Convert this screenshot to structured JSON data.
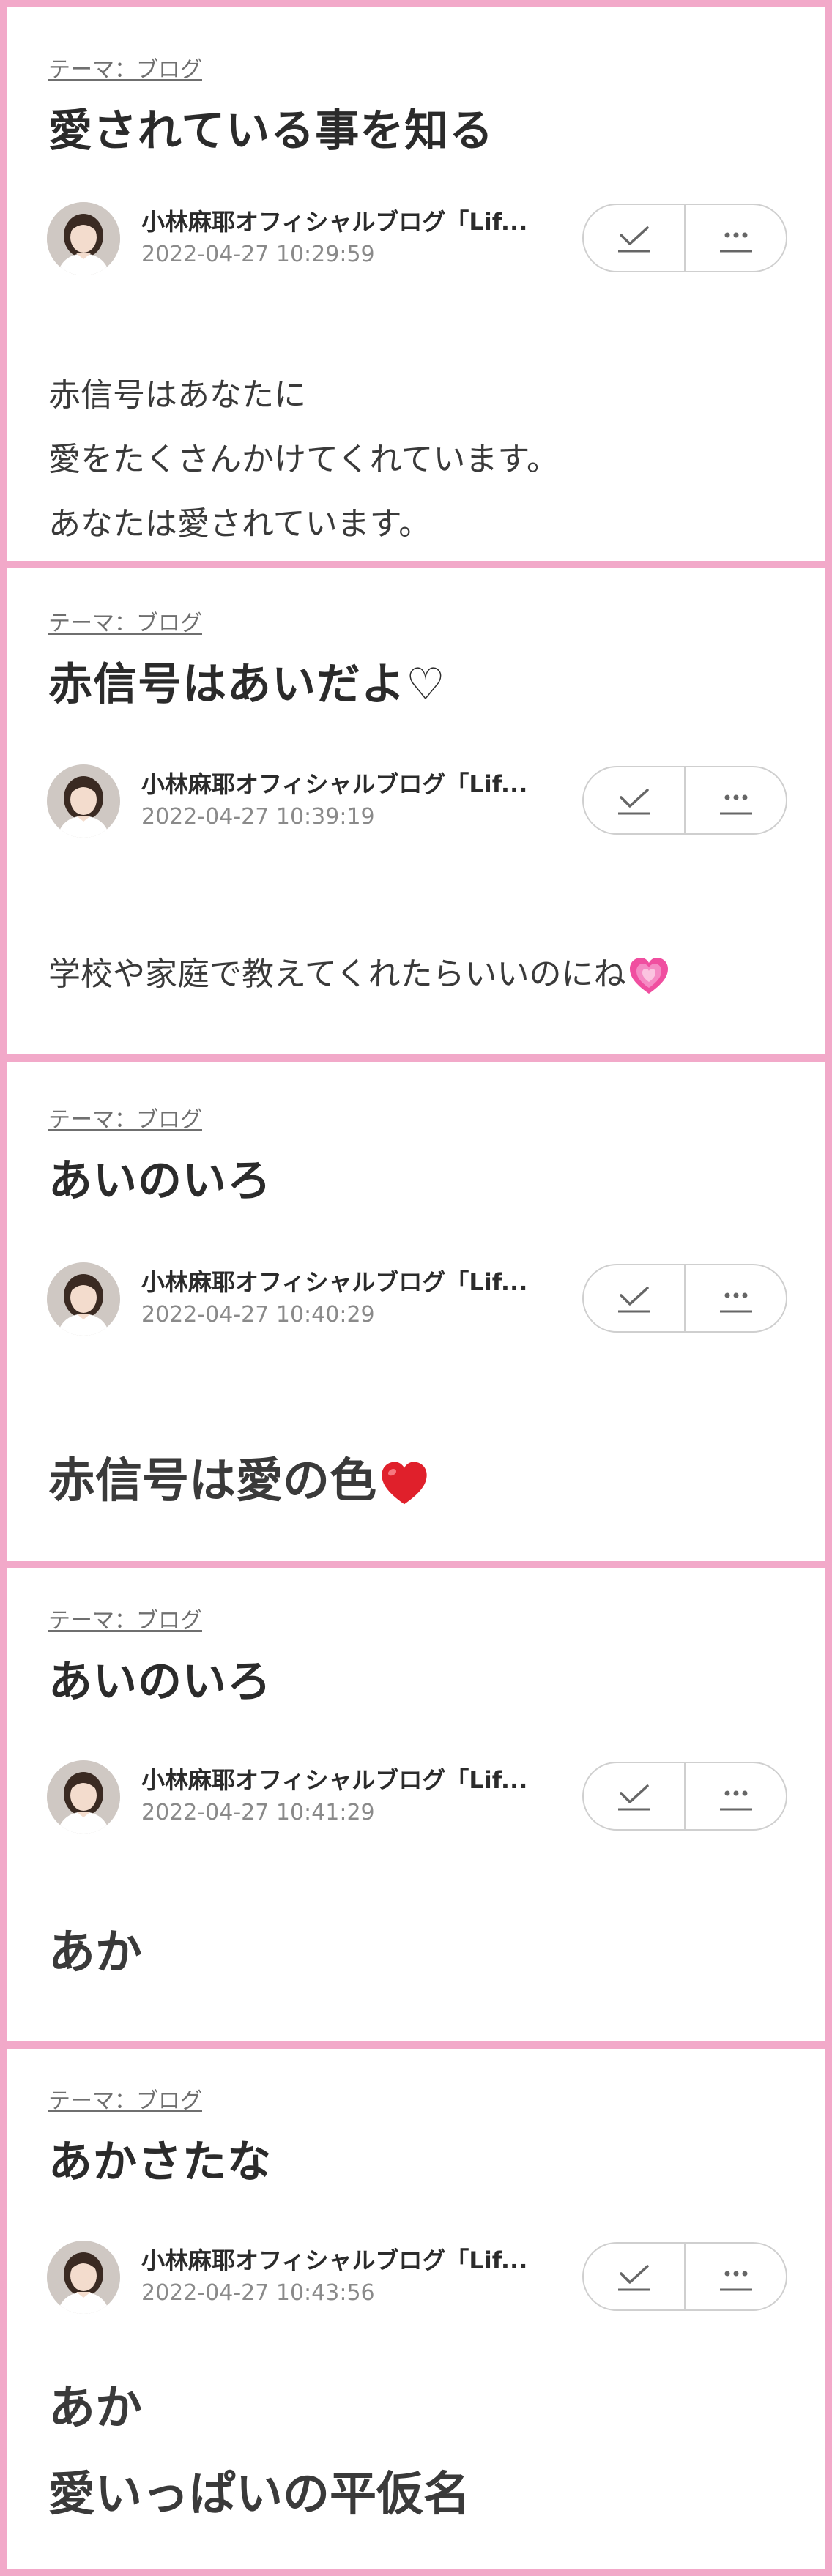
{
  "posts": [
    {
      "theme": "テーマ：ブログ",
      "title": "愛されている事を知る",
      "author": "小林麻耶オフィシャルブログ「Lif...",
      "date": "2022-04-27 10:29:59",
      "body": [
        "赤信号はあなたに",
        "愛をたくさんかけてくれています。",
        "あなたは愛されています。"
      ]
    },
    {
      "theme": "テーマ：ブログ",
      "title": "赤信号はあいだよ♡",
      "author": "小林麻耶オフィシャルブログ「Lif...",
      "date": "2022-04-27 10:39:19",
      "body": [
        "学校や家庭で教えてくれたらいいのにね"
      ],
      "emoji": "growing-heart-icon"
    },
    {
      "theme": "テーマ：ブログ",
      "title": "あいのいろ",
      "author": "小林麻耶オフィシャルブログ「Lif...",
      "date": "2022-04-27 10:40:29",
      "body": [
        "赤信号は愛の色"
      ],
      "emoji": "red-heart-icon"
    },
    {
      "theme": "テーマ：ブログ",
      "title": "あいのいろ",
      "author": "小林麻耶オフィシャルブログ「Lif...",
      "date": "2022-04-27 10:41:29",
      "body": [
        "あか"
      ]
    },
    {
      "theme": "テーマ：ブログ",
      "title": "あかさたな",
      "author": "小林麻耶オフィシャルブログ「Lif...",
      "date": "2022-04-27 10:43:56",
      "body": [
        "あか",
        "愛いっぱいの平仮名"
      ]
    }
  ],
  "icons": {
    "check": "check-icon",
    "more": "more-icon"
  },
  "colors": {
    "border_pink": "#f2a9c9",
    "title_text": "#2b2b2b",
    "meta_text": "#8a8a8a",
    "heart_red": "#e0202b",
    "heart_pink": "#f04fa0"
  }
}
